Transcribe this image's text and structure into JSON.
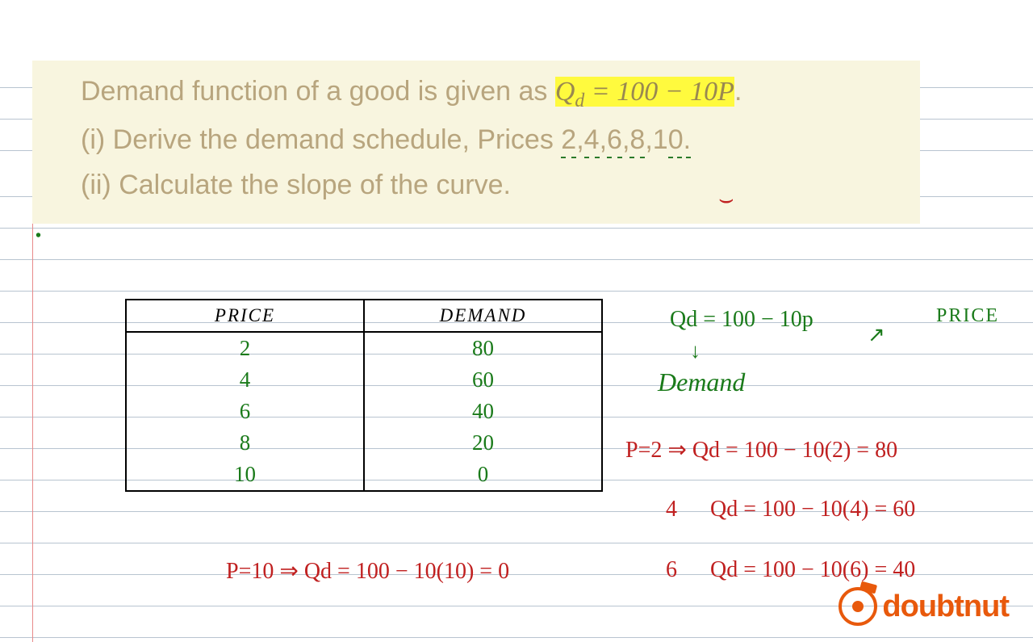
{
  "question": {
    "intro": "Demand function of a good is given as",
    "formula": "Q_d = 100 − 10P",
    "part1_prefix": "(i) Derive the demand schedule, Prices",
    "prices_text": "2,4,6,8,10.",
    "part2": "(ii) Calculate the slope of the curve."
  },
  "table": {
    "headers": {
      "col1": "PRICE",
      "col2": "DEMAND"
    },
    "rows": [
      {
        "price": "2",
        "demand": "80"
      },
      {
        "price": "4",
        "demand": "60"
      },
      {
        "price": "6",
        "demand": "40"
      },
      {
        "price": "8",
        "demand": "20"
      },
      {
        "price": "10",
        "demand": "0"
      }
    ]
  },
  "annotations": {
    "eq_main": "Qd =  100 − 10p",
    "price_label": "PRICE",
    "demand_label": "Demand",
    "calc1": "P=2 ⇒  Qd = 100 − 10(2) = 80",
    "calc2_p": "4",
    "calc2_eq": "Qd =  100 − 10(4) =  60",
    "calc3": "P=10 ⇒ Qd = 100 − 10(10) =  0",
    "calc4_p": "6",
    "calc4_eq": "Qd =  100 − 10(6)  = 40"
  },
  "chart_data": {
    "type": "table",
    "title": "Demand Schedule for Qd = 100 − 10P",
    "columns": [
      "Price",
      "Demand (Qd)"
    ],
    "rows": [
      [
        2,
        80
      ],
      [
        4,
        60
      ],
      [
        6,
        40
      ],
      [
        8,
        20
      ],
      [
        10,
        0
      ]
    ]
  },
  "logo": {
    "text": "doubtnut"
  }
}
